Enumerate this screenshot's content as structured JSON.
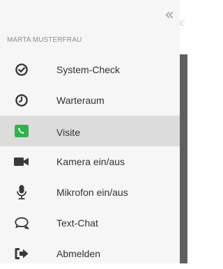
{
  "drawer": {
    "collapse_icon": "double-chevron-left-icon",
    "collapse_glyph": "«",
    "user_name": "MARTA MUSTERFRAU"
  },
  "menu": {
    "items": [
      {
        "label": "System-Check",
        "icon": "check-circle-icon",
        "active": false
      },
      {
        "label": "Warteraum",
        "icon": "clock-icon",
        "active": false
      },
      {
        "label": "Visite",
        "icon": "phone-icon",
        "active": true
      },
      {
        "label": "Kamera ein/aus",
        "icon": "video-camera-icon",
        "active": false
      },
      {
        "label": "Mikrofon ein/aus",
        "icon": "microphone-icon",
        "active": false
      },
      {
        "label": "Text-Chat",
        "icon": "chat-bubbles-icon",
        "active": false
      },
      {
        "label": "Abmelden",
        "icon": "sign-out-icon",
        "active": false
      }
    ]
  },
  "colors": {
    "accent_green": "#2db34a",
    "icon_dark": "#3a3a3a",
    "active_row": "#dcdcdc",
    "drawer_bg": "#f6f6f6"
  }
}
